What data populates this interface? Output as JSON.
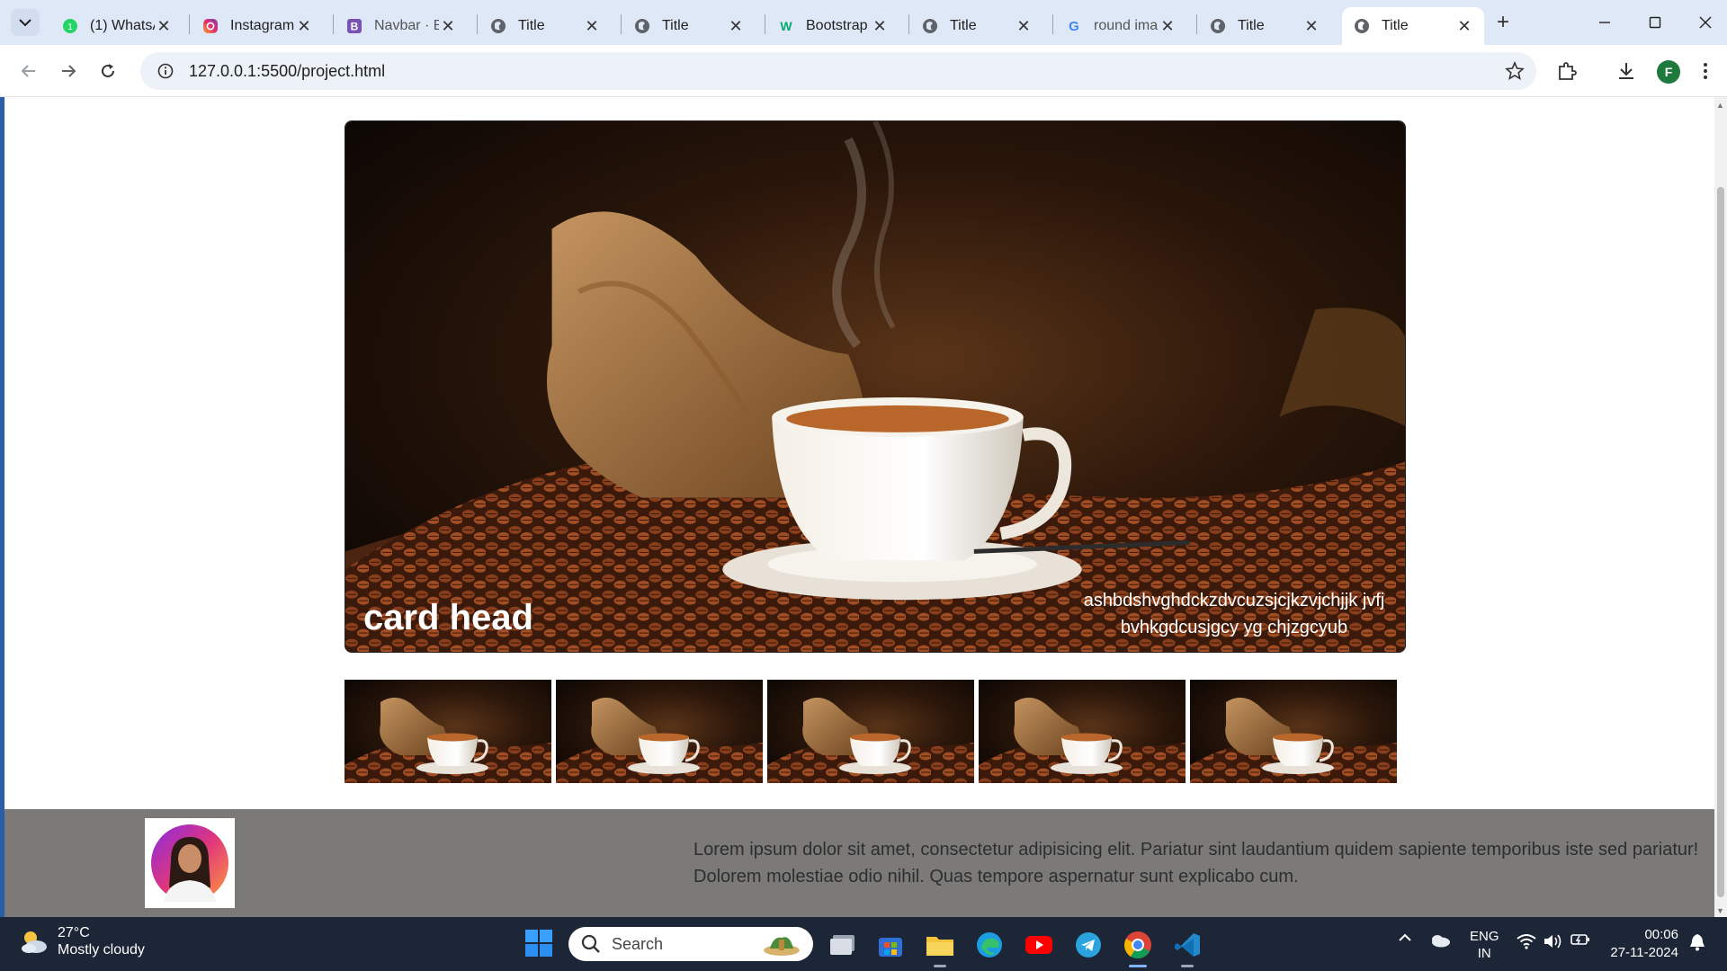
{
  "browser": {
    "tabs": [
      {
        "title": "(1) WhatsA",
        "icon": "whatsapp-icon"
      },
      {
        "title": "Instagram",
        "icon": "instagram-icon"
      },
      {
        "title": "Navbar · B",
        "icon": "bootstrap-icon"
      },
      {
        "title": "Title",
        "icon": "globe-icon"
      },
      {
        "title": "Title",
        "icon": "globe-icon"
      },
      {
        "title": "Bootstrap",
        "icon": "w3schools-icon"
      },
      {
        "title": "Title",
        "icon": "globe-icon"
      },
      {
        "title": "round ima",
        "icon": "google-icon"
      },
      {
        "title": "Title",
        "icon": "globe-icon"
      },
      {
        "title": "Title",
        "icon": "globe-icon",
        "active": true
      }
    ],
    "url": "127.0.0.1:5500/project.html",
    "profile_initial": "F"
  },
  "page": {
    "card": {
      "head": "card head",
      "text": "ashbdshvghdckzdvcuzsjcjkzvjchjjk jvfjbvhkgdcusjgcy yg chjzgcyub"
    },
    "thumbnail_count": 5,
    "footer": {
      "text": "Lorem ipsum dolor sit amet, consectetur adipisicing elit. Pariatur sint laudantium quidem sapiente temporibus iste sed pariatur! Dolorem molestiae odio nihil. Quas tempore aspernatur sunt explicabo cum."
    }
  },
  "taskbar": {
    "weather": {
      "temp": "27°C",
      "condition": "Mostly cloudy"
    },
    "search_label": "Search",
    "lang_line1": "ENG",
    "lang_line2": "IN",
    "time": "00:06",
    "date": "27-11-2024"
  },
  "colors": {
    "tabstrip": "#dfe8f7",
    "footer": "#7b7a79",
    "taskbar": "#1c2637"
  }
}
